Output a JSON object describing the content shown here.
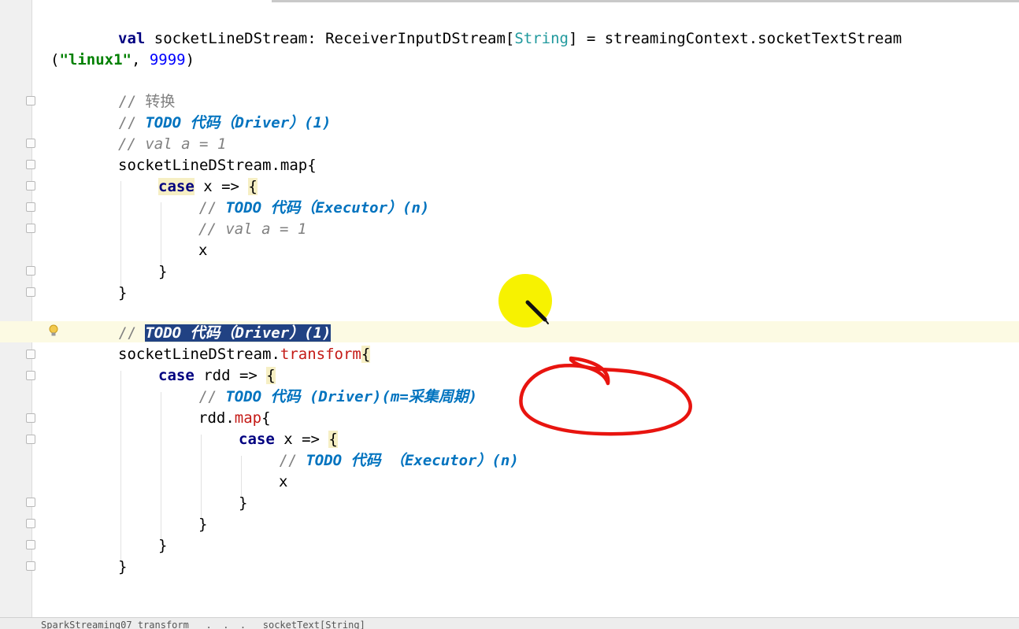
{
  "editor": {
    "lines": {
      "l1": {
        "kw": "val",
        "name": " socketLineDStream: ReceiverInputDStream[",
        "type": "String",
        "rest": "] = streamingContext.socketTextStream"
      },
      "l2": {
        "open": "(",
        "str": "\"linux1\"",
        "sep": ", ",
        "num": "9999",
        "close": ")"
      },
      "l3": {
        "text": "// 转换"
      },
      "l4": {
        "prefix": "// ",
        "todo": "TODO 代码（Driver）(1)"
      },
      "l5": {
        "text": "// val a = 1"
      },
      "l6": {
        "text": "socketLineDStream.map{"
      },
      "l7": {
        "kw": "case",
        "mid": " x => ",
        "brace": "{"
      },
      "l8": {
        "prefix": "// ",
        "todo": "TODO 代码（Executor）(n)"
      },
      "l9": {
        "text": "// val a = 1"
      },
      "l10": {
        "text": "x"
      },
      "l11": {
        "text": "}"
      },
      "l12": {
        "text": "}"
      },
      "l13": {
        "prefix": "// ",
        "todo": "TODO 代码（Driver）(1)"
      },
      "l14": {
        "obj": "socketLineDStream.",
        "method": "transform",
        "brace": "{"
      },
      "l15": {
        "kw": "case",
        "mid": " rdd => ",
        "brace": "{"
      },
      "l16": {
        "prefix": "// ",
        "todo": "TODO 代码 (Driver)(m=采集周期)"
      },
      "l17": {
        "obj": "rdd.",
        "method": "map",
        "brace": "{"
      },
      "l18": {
        "kw": "case",
        "mid": " x => ",
        "brace": "{"
      },
      "l19": {
        "prefix": "// ",
        "todo": "TODO 代码 （Executor）(n)"
      },
      "l20": {
        "text": "x"
      },
      "l21": {
        "text": "}"
      },
      "l22": {
        "text": "}"
      },
      "l23": {
        "text": "}"
      },
      "l24": {
        "text": "}"
      }
    }
  },
  "statusbar": {
    "text": "SparkStreaming07_transform   .  .  .   socketText[String]"
  },
  "colors": {
    "keyword": "#000080",
    "string": "#008000",
    "number": "#0000ff",
    "comment": "#808080",
    "todo": "#0073bf",
    "method": "#c41a16",
    "selection": "#214283",
    "annotation_circle": "#e8140f",
    "cursor_highlight": "#f7f200"
  }
}
